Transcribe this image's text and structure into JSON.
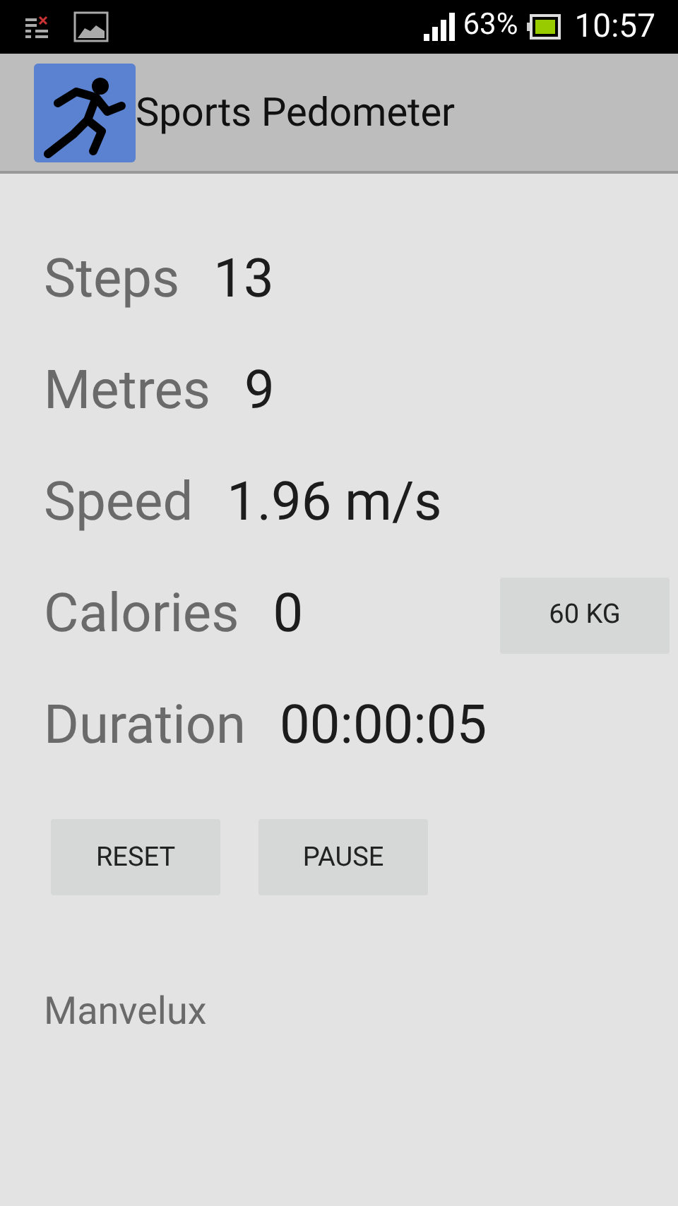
{
  "status_bar": {
    "battery": "63%",
    "time": "10:57"
  },
  "action_bar": {
    "title": "Sports Pedometer"
  },
  "stats": [
    {
      "label": "Steps",
      "value": "13"
    },
    {
      "label": "Metres",
      "value": "9"
    },
    {
      "label": "Speed",
      "value": "1.96 m/s"
    },
    {
      "label": "Calories",
      "value": "0"
    },
    {
      "label": "Duration",
      "value": "00:00:05"
    }
  ],
  "weight_button": "60 KG",
  "buttons": [
    "RESET",
    "PAUSE"
  ],
  "footer": "Manvelux"
}
